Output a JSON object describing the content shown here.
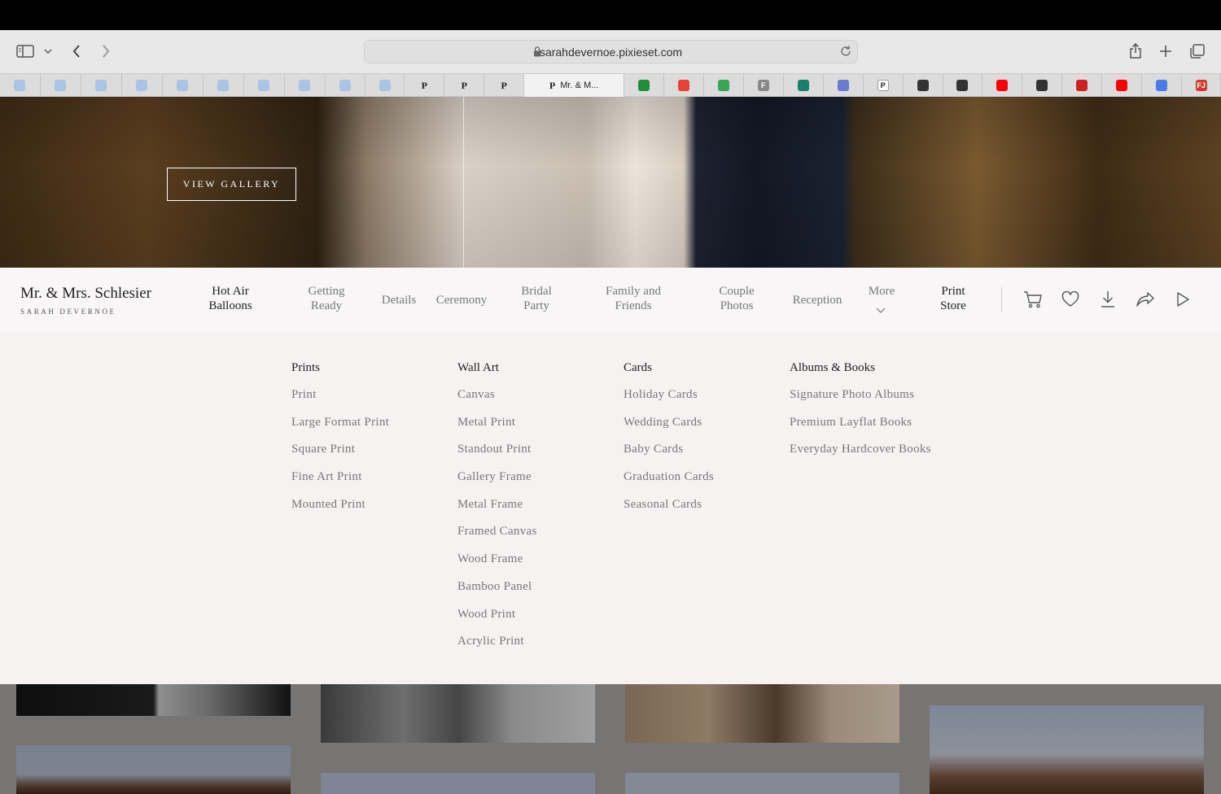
{
  "browser": {
    "url": "sarahdevernoe.pixieset.com",
    "tabs": [
      {
        "type": "fav",
        "label": "",
        "color": "#a9c4e4",
        "w": 50
      },
      {
        "type": "fav",
        "label": "",
        "color": "#a9c4e4",
        "w": 50
      },
      {
        "type": "fav",
        "label": "",
        "color": "#a9c4e4",
        "w": 50
      },
      {
        "type": "fav",
        "label": "",
        "color": "#a9c4e4",
        "w": 50
      },
      {
        "type": "fav",
        "label": "",
        "color": "#a9c4e4",
        "w": 50
      },
      {
        "type": "fav",
        "label": "",
        "color": "#a9c4e4",
        "w": 50
      },
      {
        "type": "fav",
        "label": "",
        "color": "#a9c4e4",
        "w": 50
      },
      {
        "type": "fav",
        "label": "",
        "color": "#a9c4e4",
        "w": 50
      },
      {
        "type": "fav",
        "label": "",
        "color": "#a9c4e4",
        "w": 50
      },
      {
        "type": "fav",
        "label": "",
        "color": "#a9c4e4",
        "w": 48
      },
      {
        "type": "p",
        "label": "P",
        "w": 49
      },
      {
        "type": "p",
        "label": "P",
        "w": 49
      },
      {
        "type": "p",
        "label": "P",
        "w": 49
      },
      {
        "type": "active",
        "label": "Mr. & M...",
        "w": 123
      },
      {
        "type": "fav",
        "label": "",
        "color": "#1d8f3a",
        "w": 49
      },
      {
        "type": "fav",
        "label": "",
        "color": "#e84234",
        "w": 49
      },
      {
        "type": "fav",
        "label": "",
        "color": "#34a853",
        "w": 49
      },
      {
        "type": "fav",
        "label": "F",
        "color": "#888888",
        "w": 49
      },
      {
        "type": "fav",
        "label": "",
        "color": "#17826b",
        "w": 49
      },
      {
        "type": "fav",
        "label": "",
        "color": "#6a7bd1",
        "w": 49
      },
      {
        "type": "fav",
        "label": "P",
        "color": "#ffffff",
        "w": 49
      },
      {
        "type": "fav",
        "label": "",
        "color": "#333333",
        "w": 49
      },
      {
        "type": "fav",
        "label": "",
        "color": "#333333",
        "w": 49
      },
      {
        "type": "fav",
        "label": "",
        "color": "#ff0000",
        "w": 49
      },
      {
        "type": "fav",
        "label": "",
        "color": "#333333",
        "w": 49
      },
      {
        "type": "fav",
        "label": "",
        "color": "#cc2222",
        "w": 49
      },
      {
        "type": "fav",
        "label": "",
        "color": "#ff0000",
        "w": 49
      },
      {
        "type": "fav",
        "label": "",
        "color": "#4a7ce8",
        "w": 49
      },
      {
        "type": "fav",
        "label": "FJ",
        "color": "#d63a2e",
        "w": 48
      }
    ]
  },
  "hero": {
    "button": "VIEW GALLERY"
  },
  "nav": {
    "title": "Mr. & Mrs. Schlesier",
    "subtitle": "SARAH DEVERNOE",
    "items": [
      {
        "label": "Hot Air\nBalloons",
        "dark": true,
        "single": false
      },
      {
        "label": "Getting\nReady",
        "dark": false,
        "single": false
      },
      {
        "label": "Details",
        "dark": false,
        "single": true
      },
      {
        "label": "Ceremony",
        "dark": false,
        "single": true
      },
      {
        "label": "Bridal\nParty",
        "dark": false,
        "single": false
      },
      {
        "label": "Family and\nFriends",
        "dark": false,
        "single": false
      },
      {
        "label": "Couple\nPhotos",
        "dark": false,
        "single": false
      },
      {
        "label": "Reception",
        "dark": false,
        "single": true
      },
      {
        "label": "More",
        "dark": false,
        "single": false
      },
      {
        "label": "Print\nStore",
        "dark": true,
        "single": false
      }
    ]
  },
  "store_menu": {
    "columns": [
      {
        "heading": "Prints",
        "items": [
          "Print",
          "Large Format Print",
          "Square Print",
          "Fine Art Print",
          "Mounted Print"
        ]
      },
      {
        "heading": "Wall Art",
        "items": [
          "Canvas",
          "Metal Print",
          "Standout Print",
          "Gallery Frame",
          "Metal Frame",
          "Framed Canvas",
          "Wood Frame",
          "Bamboo Panel",
          "Wood Print",
          "Acrylic Print"
        ]
      },
      {
        "heading": "Cards",
        "items": [
          "Holiday Cards",
          "Wedding Cards",
          "Baby Cards",
          "Graduation Cards",
          "Seasonal Cards"
        ]
      },
      {
        "heading": "Albums & Books",
        "items": [
          "Signature Photo Albums",
          "Premium Layflat Books",
          "Everyday Hardcover Books"
        ]
      }
    ]
  }
}
